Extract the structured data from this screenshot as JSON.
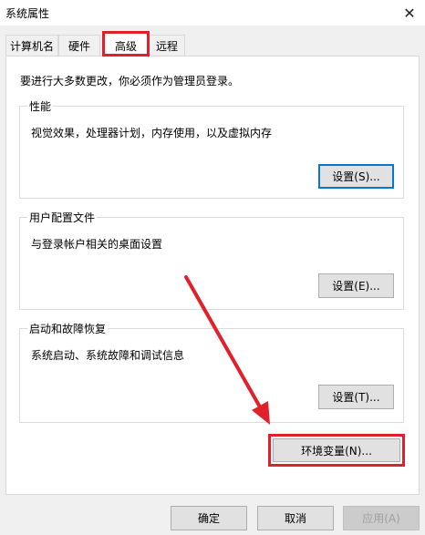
{
  "window": {
    "title": "系统属性",
    "close_glyph": "✕"
  },
  "tabs": [
    {
      "label": "计算机名"
    },
    {
      "label": "硬件"
    },
    {
      "label": "高级"
    },
    {
      "label": "远程"
    }
  ],
  "notice": "要进行大多数更改，你必须作为管理员登录。",
  "groups": {
    "performance": {
      "title": "性能",
      "desc": "视觉效果，处理器计划，内存使用，以及虚拟内存",
      "button": "设置(S)..."
    },
    "profiles": {
      "title": "用户配置文件",
      "desc": "与登录帐户相关的桌面设置",
      "button": "设置(E)..."
    },
    "startup": {
      "title": "启动和故障恢复",
      "desc": "系统启动、系统故障和调试信息",
      "button": "设置(T)..."
    }
  },
  "env_button": "环境变量(N)...",
  "footer": {
    "ok": "确定",
    "cancel": "取消",
    "apply": "应用(A)"
  },
  "colors": {
    "highlight": "#e0202a",
    "focus": "#0078d7"
  }
}
